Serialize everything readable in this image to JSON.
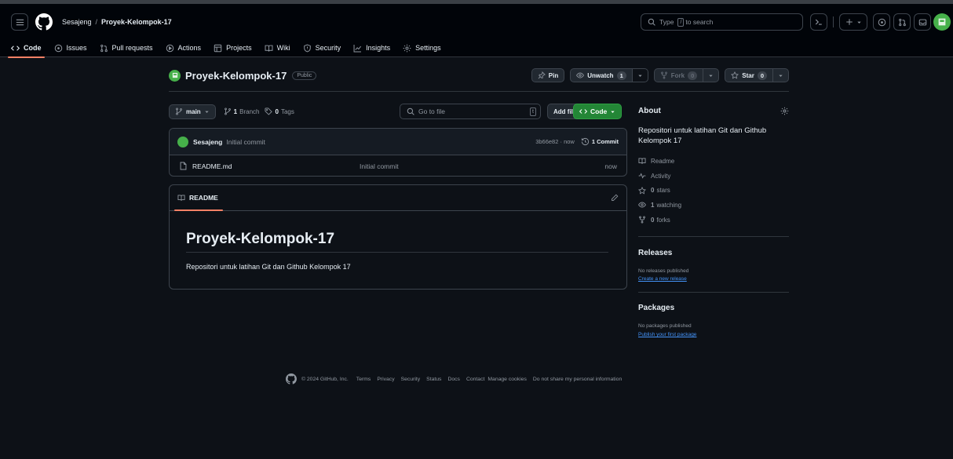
{
  "header": {
    "owner": "Sesajeng",
    "separator": "/",
    "repo": "Proyek-Kelompok-17",
    "search_placeholder": "Type",
    "search_key": "/",
    "search_suffix": "to search"
  },
  "tabs": [
    {
      "label": "Code",
      "icon": "code-icon",
      "active": true
    },
    {
      "label": "Issues",
      "icon": "issue-icon"
    },
    {
      "label": "Pull requests",
      "icon": "pull-request-icon"
    },
    {
      "label": "Actions",
      "icon": "play-icon"
    },
    {
      "label": "Projects",
      "icon": "table-icon"
    },
    {
      "label": "Wiki",
      "icon": "book-icon"
    },
    {
      "label": "Security",
      "icon": "shield-icon"
    },
    {
      "label": "Insights",
      "icon": "graph-icon"
    },
    {
      "label": "Settings",
      "icon": "gear-icon"
    }
  ],
  "repo": {
    "title": "Proyek-Kelompok-17",
    "visibility": "Public",
    "pin_label": "Pin",
    "unwatch_label": "Unwatch",
    "watch_count": "1",
    "fork_label": "Fork",
    "fork_count": "0",
    "star_label": "Star",
    "star_count": "0"
  },
  "filenav": {
    "branch": "main",
    "branch_count": "1",
    "branch_label": "Branch",
    "tag_count": "0",
    "tag_label": "Tags",
    "goto_placeholder": "Go to file",
    "goto_key": "t",
    "add_file": "Add file",
    "code_label": "Code"
  },
  "commit": {
    "user": "Sesajeng",
    "message": "Initial commit",
    "hash_time": "3b66e82 · now",
    "count_label": "1 Commit"
  },
  "files": [
    {
      "name": "README.md",
      "commit": "Initial commit",
      "time": "now"
    }
  ],
  "readme": {
    "tab_label": "README",
    "heading": "Proyek-Kelompok-17",
    "body": "Repositori untuk latihan Git dan Github Kelompok 17"
  },
  "about": {
    "title": "About",
    "description": "Repositori untuk latihan Git dan Github Kelompok 17",
    "items": [
      {
        "icon": "book-icon",
        "label": "Readme",
        "value": ""
      },
      {
        "icon": "pulse-icon",
        "label": "Activity",
        "value": ""
      },
      {
        "icon": "star-icon",
        "label": "stars",
        "value": "0"
      },
      {
        "icon": "eye-icon",
        "label": "watching",
        "value": "1"
      },
      {
        "icon": "fork-icon",
        "label": "forks",
        "value": "0"
      }
    ]
  },
  "releases": {
    "title": "Releases",
    "note": "No releases published",
    "link": "Create a new release"
  },
  "packages": {
    "title": "Packages",
    "note": "No packages published",
    "link": "Publish your first package"
  },
  "footer": {
    "copyright": "© 2024 GitHub, Inc.",
    "links": [
      "Terms",
      "Privacy",
      "Security",
      "Status",
      "Docs",
      "Contact",
      "Manage cookies",
      "Do not share my personal information"
    ]
  },
  "colors": {
    "background": "#0d1117",
    "header": "#010409",
    "accent_tab": "#f78166",
    "primary_button": "#238636",
    "link": "#4493f8"
  }
}
